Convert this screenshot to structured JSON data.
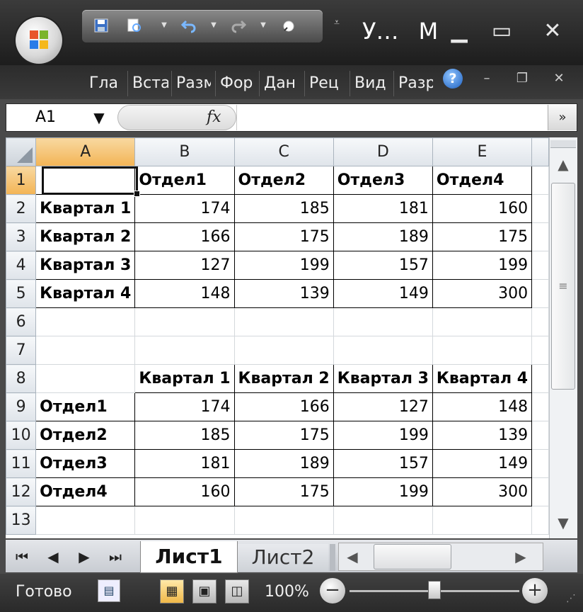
{
  "window": {
    "title": "У…",
    "title_suffix": "М",
    "minimize_icon": "minimize-icon",
    "maximize_icon": "maximize-icon",
    "close_icon": "close-icon"
  },
  "quick_access": [
    "save-icon",
    "print-preview-icon",
    "undo-icon",
    "redo-icon",
    "spelling-icon"
  ],
  "ribbon": {
    "tabs": [
      "Гла",
      "Вста",
      "Разм",
      "Фор",
      "Дан",
      "Рец",
      "Вид",
      "Разр"
    ],
    "help": "?"
  },
  "formula_bar": {
    "name_box": "A1",
    "fx_label": "fx",
    "formula": ""
  },
  "grid": {
    "columns": [
      "A",
      "B",
      "C",
      "D",
      "E"
    ],
    "rows": [
      {
        "n": "1",
        "cells": [
          "",
          "Отдел1",
          "Отдел2",
          "Отдел3",
          "Отдел4"
        ]
      },
      {
        "n": "2",
        "cells": [
          "Квартал 1",
          "174",
          "185",
          "181",
          "160"
        ]
      },
      {
        "n": "3",
        "cells": [
          "Квартал 2",
          "166",
          "175",
          "189",
          "175"
        ]
      },
      {
        "n": "4",
        "cells": [
          "Квартал 3",
          "127",
          "199",
          "157",
          "199"
        ]
      },
      {
        "n": "5",
        "cells": [
          "Квартал 4",
          "148",
          "139",
          "149",
          "300"
        ]
      },
      {
        "n": "6",
        "cells": [
          "",
          "",
          "",
          "",
          ""
        ]
      },
      {
        "n": "7",
        "cells": [
          "",
          "",
          "",
          "",
          ""
        ]
      },
      {
        "n": "8",
        "cells": [
          "",
          "Квартал 1",
          "Квартал 2",
          "Квартал 3",
          "Квартал 4"
        ]
      },
      {
        "n": "9",
        "cells": [
          "Отдел1",
          "174",
          "166",
          "127",
          "148"
        ]
      },
      {
        "n": "10",
        "cells": [
          "Отдел2",
          "185",
          "175",
          "199",
          "139"
        ]
      },
      {
        "n": "11",
        "cells": [
          "Отдел3",
          "181",
          "189",
          "157",
          "149"
        ]
      },
      {
        "n": "12",
        "cells": [
          "Отдел4",
          "160",
          "175",
          "199",
          "300"
        ]
      },
      {
        "n": "13",
        "cells": [
          "",
          "",
          "",
          "",
          ""
        ]
      }
    ],
    "active_cell": "A1"
  },
  "sheets": {
    "tabs": [
      "Лист1",
      "Лист2"
    ],
    "active": "Лист1"
  },
  "status": {
    "text": "Готово",
    "zoom": "100%",
    "zoom_fraction": 0.5
  },
  "colors": {
    "selected_header": "#f3b455",
    "chrome_dark": "#2c2c2c"
  }
}
